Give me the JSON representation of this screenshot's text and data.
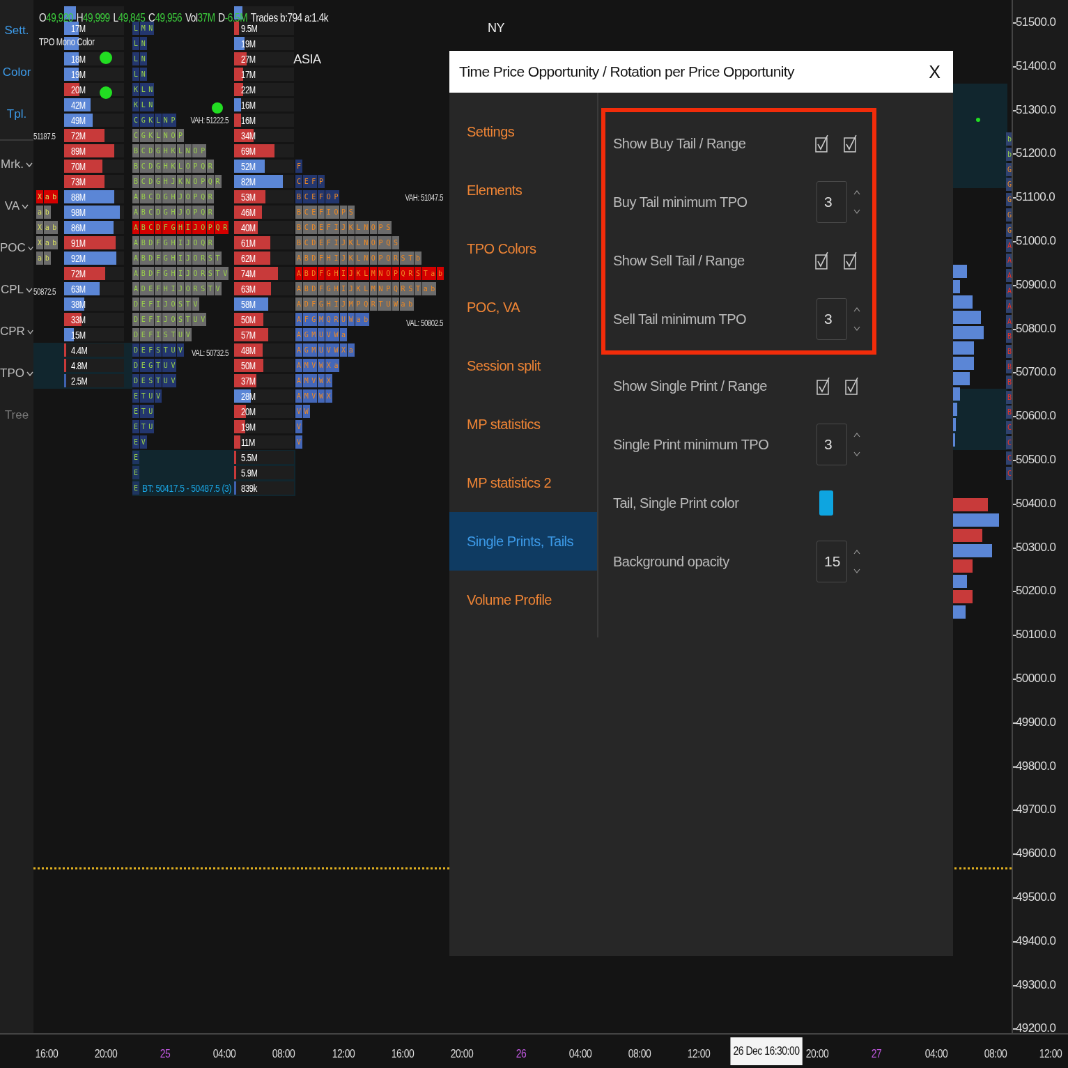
{
  "toolbar": [
    {
      "label": "Sett.",
      "kind": "link",
      "menu": false
    },
    {
      "label": "Color",
      "kind": "link",
      "menu": false
    },
    {
      "label": "Tpl.",
      "kind": "link",
      "menu": false
    },
    {
      "label": "Mrk.",
      "kind": "toggle",
      "menu": true
    },
    {
      "label": "VA",
      "kind": "toggle",
      "menu": true
    },
    {
      "label": "POC",
      "kind": "toggle",
      "menu": true
    },
    {
      "label": "CPL",
      "kind": "toggle",
      "menu": true
    },
    {
      "label": "CPR",
      "kind": "toggle",
      "menu": true
    },
    {
      "label": "TPO",
      "kind": "toggle",
      "menu": true
    },
    {
      "label": "Tree",
      "kind": "toggle",
      "menu": false
    }
  ],
  "ohlc": [
    {
      "label": "O",
      "value": "49,920"
    },
    {
      "label": "H",
      "value": "49,999"
    },
    {
      "label": "L",
      "value": "49,845"
    },
    {
      "label": "C",
      "value": "49,956"
    },
    {
      "label": "Vol",
      "value": "37M"
    },
    {
      "label": "D",
      "value": "-6.5M"
    }
  ],
  "trades": "Trades b:794 a:1.4k",
  "chart_labels": [
    {
      "text": "TPO Mono Color",
      "kind": "note"
    },
    {
      "text": "NY",
      "kind": "session"
    },
    {
      "text": "ASIA",
      "kind": "session"
    },
    {
      "text": "51187.5",
      "kind": "price"
    },
    {
      "text": "VAH: 51222.5",
      "kind": "price"
    },
    {
      "text": "50872.5",
      "kind": "price"
    },
    {
      "text": "VAL: 50732.5",
      "kind": "price"
    },
    {
      "text": "VAH: 51047.5",
      "kind": "price"
    },
    {
      "text": "VAL: 50802.5",
      "kind": "price"
    },
    {
      "text": "BT: 50417.5 - 50487.5 (3)",
      "kind": "tail"
    }
  ],
  "volume_profiles": [
    {
      "bars": [
        {
          "kind": "buy",
          "level": 0.2
        },
        {
          "label": "17M",
          "kind": "buy",
          "level": 0.24
        },
        {
          "kind": "buy",
          "level": 0.24
        },
        {
          "label": "18M",
          "kind": "buy",
          "level": 0.24
        },
        {
          "label": "19M",
          "kind": "buy",
          "level": 0.24
        },
        {
          "label": "20M",
          "kind": "sell",
          "level": 0.26
        },
        {
          "label": "42M",
          "kind": "buy",
          "level": 0.44
        },
        {
          "label": "49M",
          "kind": "buy",
          "level": 0.48
        },
        {
          "label": "72M",
          "kind": "sell",
          "level": 0.68
        },
        {
          "label": "89M",
          "kind": "sell",
          "level": 0.84
        },
        {
          "label": "70M",
          "kind": "sell",
          "level": 0.64
        },
        {
          "label": "73M",
          "kind": "sell",
          "level": 0.68
        },
        {
          "label": "88M",
          "kind": "buy",
          "level": 0.84
        },
        {
          "label": "98M",
          "kind": "buy",
          "level": 0.93
        },
        {
          "label": "86M",
          "kind": "buy",
          "level": 0.82
        },
        {
          "label": "91M",
          "kind": "sell",
          "level": 0.86
        },
        {
          "label": "92M",
          "kind": "buy",
          "level": 0.87
        },
        {
          "label": "72M",
          "kind": "sell",
          "level": 0.69
        },
        {
          "label": "63M",
          "kind": "buy",
          "level": 0.59
        },
        {
          "label": "38M",
          "kind": "buy",
          "level": 0.34
        },
        {
          "label": "33M",
          "kind": "sell",
          "level": 0.29
        },
        {
          "label": "15M",
          "kind": "buy",
          "level": 0.16
        },
        {
          "label": "4.4M",
          "kind": "sell",
          "level": 0.03
        },
        {
          "label": "4.8M",
          "kind": "sell",
          "level": 0.03
        },
        {
          "label": "2.5M",
          "kind": "none",
          "level": 0.02
        }
      ]
    },
    {
      "bars": [
        {
          "kind": "buy",
          "level": 0.14
        },
        {
          "label": "9.5M",
          "kind": "sell",
          "level": 0.08
        },
        {
          "label": "19M",
          "kind": "buy",
          "level": 0.18
        },
        {
          "label": "27M",
          "kind": "sell",
          "level": 0.21
        },
        {
          "label": "17M",
          "kind": "sell",
          "level": 0.15
        },
        {
          "label": "22M",
          "kind": "sell",
          "level": 0.15
        },
        {
          "label": "16M",
          "kind": "buy",
          "level": 0.12
        },
        {
          "label": "16M",
          "kind": "sell",
          "level": 0.12
        },
        {
          "label": "34M",
          "kind": "sell",
          "level": 0.33
        },
        {
          "label": "69M",
          "kind": "sell",
          "level": 0.68
        },
        {
          "label": "52M",
          "kind": "buy",
          "level": 0.51
        },
        {
          "label": "82M",
          "kind": "buy",
          "level": 0.81
        },
        {
          "label": "53M",
          "kind": "sell",
          "level": 0.52
        },
        {
          "label": "46M",
          "kind": "sell",
          "level": 0.46
        },
        {
          "label": "40M",
          "kind": "sell",
          "level": 0.39
        },
        {
          "label": "61M",
          "kind": "sell",
          "level": 0.61
        },
        {
          "label": "62M",
          "kind": "sell",
          "level": 0.61
        },
        {
          "label": "74M",
          "kind": "sell",
          "level": 0.73
        },
        {
          "label": "63M",
          "kind": "sell",
          "level": 0.62
        },
        {
          "label": "58M",
          "kind": "buy",
          "level": 0.57
        },
        {
          "label": "50M",
          "kind": "sell",
          "level": 0.49
        },
        {
          "label": "57M",
          "kind": "sell",
          "level": 0.57
        },
        {
          "label": "48M",
          "kind": "sell",
          "level": 0.48
        },
        {
          "label": "50M",
          "kind": "sell",
          "level": 0.49
        },
        {
          "label": "37M",
          "kind": "sell",
          "level": 0.37
        },
        {
          "label": "28M",
          "kind": "buy",
          "level": 0.28
        },
        {
          "label": "20M",
          "kind": "sell",
          "level": 0.2
        },
        {
          "label": "19M",
          "kind": "sell",
          "level": 0.19
        },
        {
          "label": "11M",
          "kind": "sell",
          "level": 0.11
        },
        {
          "label": "5.5M",
          "kind": "sell",
          "level": 0.03
        },
        {
          "label": "5.9M",
          "kind": "sell",
          "level": 0.03
        },
        {
          "label": "839k",
          "kind": "none",
          "level": 0.02
        }
      ]
    }
  ],
  "tpo_profiles": [
    {
      "rows": [
        {
          "letters": "L M N",
          "kind": "out"
        },
        {
          "letters": "L N",
          "kind": "out"
        },
        {
          "letters": "L N",
          "kind": "out"
        },
        {
          "letters": "L N",
          "kind": "out"
        },
        {
          "letters": "K L N",
          "kind": "out"
        },
        {
          "letters": "K L N",
          "kind": "out"
        },
        {
          "letters": "C G K L N P",
          "kind": "out"
        },
        {
          "letters": "C G K L N O P",
          "kind": "va"
        },
        {
          "letters": "B C D G H K L N O P",
          "kind": "va"
        },
        {
          "letters": "B C D G H K L O P Q R",
          "kind": "va"
        },
        {
          "letters": "B C D G H J K N O P Q R",
          "kind": "va"
        },
        {
          "letters": "A B C D G H J O P Q R",
          "kind": "va"
        },
        {
          "letters": "A B C D G H J O P Q R",
          "kind": "va"
        },
        {
          "letters": "A B C D F G H I J O P Q R",
          "kind": "poc"
        },
        {
          "letters": "A B D F G H I J O Q R",
          "kind": "va"
        },
        {
          "letters": "A B D F G H I J O R S T",
          "kind": "va"
        },
        {
          "letters": "A B D F G H I J O R S T V",
          "kind": "va"
        },
        {
          "letters": "A D E F H I J O R S T V",
          "kind": "va"
        },
        {
          "letters": "D E F I J O S T V",
          "kind": "va"
        },
        {
          "letters": "D E F I J O S T U V",
          "kind": "va"
        },
        {
          "letters": "D E F I S T U V",
          "kind": "va"
        },
        {
          "letters": "D E F S T U V",
          "kind": "out"
        },
        {
          "letters": "D E G T U V",
          "kind": "out"
        },
        {
          "letters": "D E S T U V",
          "kind": "out"
        },
        {
          "letters": "E T U V",
          "kind": "out"
        },
        {
          "letters": "E T U",
          "kind": "out"
        },
        {
          "letters": "E T U",
          "kind": "out"
        },
        {
          "letters": "E V",
          "kind": "out"
        },
        {
          "letters": "E",
          "kind": "tail"
        },
        {
          "letters": "E",
          "kind": "tail"
        },
        {
          "letters": "E",
          "kind": "tail"
        }
      ]
    },
    {
      "rows": [
        {
          "letters": "F",
          "kind": "out"
        },
        {
          "letters": "C E F P",
          "kind": "out"
        },
        {
          "letters": "B C E F O P",
          "kind": "out"
        },
        {
          "letters": "B C E F I O P S",
          "kind": "va"
        },
        {
          "letters": "B C D E F I J K L N O P S",
          "kind": "va"
        },
        {
          "letters": "B C D E F I J K L N O P Q S",
          "kind": "va"
        },
        {
          "letters": "A B D F H I J K L N O P Q R S T b",
          "kind": "va"
        },
        {
          "letters": "A B D F G H I J K L M N O P Q R S T a b",
          "kind": "poc"
        },
        {
          "letters": "A B D F G H I J K L M N P Q R S T a b",
          "kind": "va"
        },
        {
          "letters": "A D F G H I J M P Q R T U W a b",
          "kind": "va"
        },
        {
          "letters": "A F G M Q R U W a b",
          "kind": "low"
        },
        {
          "letters": "A G M U V W a",
          "kind": "low"
        },
        {
          "letters": "A G M U V W X a",
          "kind": "low"
        },
        {
          "letters": "A M V W X a",
          "kind": "low"
        },
        {
          "letters": "A M V W X",
          "kind": "low"
        },
        {
          "letters": "A M V W X",
          "kind": "low"
        },
        {
          "letters": "V W",
          "kind": "low"
        },
        {
          "letters": "V",
          "kind": "low"
        },
        {
          "letters": "V",
          "kind": "low"
        }
      ]
    }
  ],
  "mini_profile": [
    {
      "letters": "X a b",
      "kind": "poc"
    },
    {
      "letters": "a b",
      "kind": "va"
    },
    {
      "letters": "X a b",
      "kind": "va"
    },
    {
      "letters": "X a b",
      "kind": "va"
    },
    {
      "letters": "a b",
      "kind": "va"
    }
  ],
  "right_column": [
    "b",
    "b",
    "G",
    "G",
    "G",
    "G",
    "G",
    "A",
    "A",
    "A",
    "A",
    "A",
    "A",
    "B",
    "B",
    "B",
    "B",
    "B",
    "B",
    "C",
    "C",
    "C",
    "C"
  ],
  "price_axis": [
    "51500.0",
    "51400.0",
    "51300.0",
    "51200.0",
    "51100.0",
    "51000.0",
    "50900.0",
    "50800.0",
    "50700.0",
    "50600.0",
    "50500.0",
    "50400.0",
    "50300.0",
    "50200.0",
    "50100.0",
    "50000.0",
    "49900.0",
    "49800.0",
    "49700.0",
    "49600.0",
    "49500.0",
    "49400.0",
    "49300.0",
    "49200.0"
  ],
  "time_axis": [
    {
      "text": "16:00",
      "kind": "time"
    },
    {
      "text": "20:00",
      "kind": "time"
    },
    {
      "text": "25",
      "kind": "day"
    },
    {
      "text": "04:00",
      "kind": "time"
    },
    {
      "text": "08:00",
      "kind": "time"
    },
    {
      "text": "12:00",
      "kind": "time"
    },
    {
      "text": "16:00",
      "kind": "time"
    },
    {
      "text": "20:00",
      "kind": "time"
    },
    {
      "text": "26",
      "kind": "day"
    },
    {
      "text": "04:00",
      "kind": "time"
    },
    {
      "text": "08:00",
      "kind": "time"
    },
    {
      "text": "12:00",
      "kind": "time"
    },
    {
      "text": "26 Dec 16:30:00",
      "kind": "cursor"
    },
    {
      "text": "20:00",
      "kind": "time"
    },
    {
      "text": "27",
      "kind": "day"
    },
    {
      "text": "04:00",
      "kind": "time"
    },
    {
      "text": "08:00",
      "kind": "time"
    },
    {
      "text": "12:00",
      "kind": "time"
    }
  ],
  "dialog": {
    "title": "Time Price Opportunity / Rotation per Price Opportunity",
    "close": "X",
    "nav": [
      {
        "label": "Settings",
        "selected": false
      },
      {
        "label": "Elements",
        "selected": false
      },
      {
        "label": "TPO Colors",
        "selected": false
      },
      {
        "label": "POC, VA",
        "selected": false
      },
      {
        "label": "Session split",
        "selected": false
      },
      {
        "label": "MP statistics",
        "selected": false
      },
      {
        "label": "MP statistics 2",
        "selected": false
      },
      {
        "label": "Single Prints, Tails",
        "selected": true
      },
      {
        "label": "Volume Profile",
        "selected": false
      }
    ],
    "highlighted_settings": [
      {
        "label": "Show Buy Tail / Range",
        "kind": "checks",
        "show": true,
        "range": true
      },
      {
        "label": "Buy Tail minimum TPO",
        "kind": "number",
        "value": "3"
      },
      {
        "label": "Show Sell Tail / Range",
        "kind": "checks",
        "show": true,
        "range": true
      },
      {
        "label": "Sell Tail minimum TPO",
        "kind": "number",
        "value": "3"
      }
    ],
    "settings": [
      {
        "label": "Show Single Print / Range",
        "kind": "checks",
        "show": true,
        "range": true
      },
      {
        "label": "Single Print minimum TPO",
        "kind": "number",
        "value": "3"
      },
      {
        "label": "Tail, Single Print color",
        "kind": "color",
        "color": "#0ea5e0"
      },
      {
        "label": "Background opacity",
        "kind": "number",
        "value": "15"
      }
    ]
  }
}
